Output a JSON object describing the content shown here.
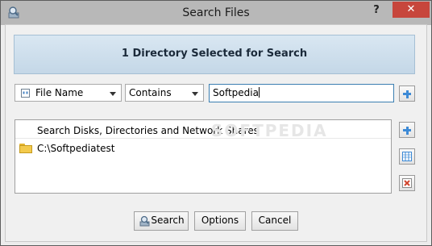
{
  "window": {
    "title": "Search Files",
    "help_glyph": "?",
    "close_glyph": "✕"
  },
  "banner": {
    "text": "1 Directory Selected for Search"
  },
  "criteria": {
    "field": "File Name",
    "operator": "Contains",
    "value": "Softpedia"
  },
  "list": {
    "header": "Search Disks, Directories and Network Shares",
    "items": [
      {
        "path": "C:\\Softpediatest"
      }
    ]
  },
  "buttons": {
    "search": "Search",
    "options": "Options",
    "cancel": "Cancel"
  },
  "watermark": "SOFTPEDIA",
  "colors": {
    "accent": "#3d8ad6",
    "close": "#c7463c",
    "banner": "#c4d7e7"
  }
}
